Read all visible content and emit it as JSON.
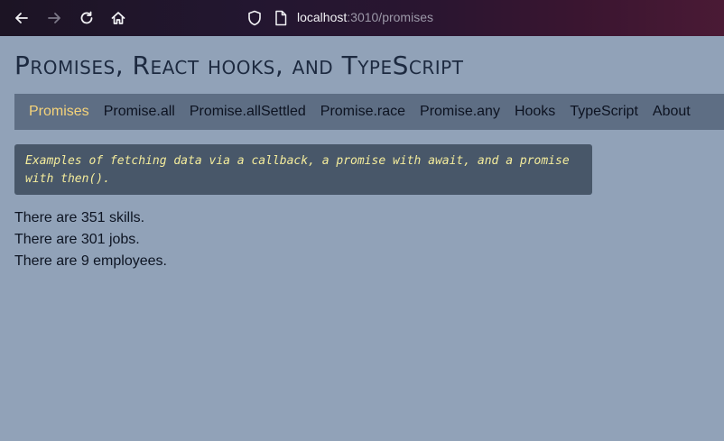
{
  "browser": {
    "url_host": "localhost",
    "url_path": ":3010/promises",
    "icons": {
      "back": "arrow-left-icon",
      "forward": "arrow-right-icon",
      "reload": "reload-icon",
      "home": "home-icon",
      "shield": "shield-icon",
      "page": "page-icon"
    }
  },
  "page": {
    "title": "Promises, React hooks, and TypeScript",
    "nav": [
      {
        "label": "Promises",
        "active": true
      },
      {
        "label": "Promise.all"
      },
      {
        "label": "Promise.allSettled"
      },
      {
        "label": "Promise.race"
      },
      {
        "label": "Promise.any"
      },
      {
        "label": "Hooks"
      },
      {
        "label": "TypeScript"
      },
      {
        "label": "About"
      }
    ],
    "note": "Examples of fetching data via a callback, a promise with await, and a promise with then().",
    "results": [
      "There are 351 skills.",
      "There are 301 jobs.",
      "There are 9 employees."
    ]
  },
  "colors": {
    "background": "#91a2b8",
    "nav_bg": "#5e6e84",
    "nav_active": "#f5d37a",
    "note_bg": "#485769",
    "note_text": "#f4ec9c",
    "title": "#1d2a40"
  }
}
